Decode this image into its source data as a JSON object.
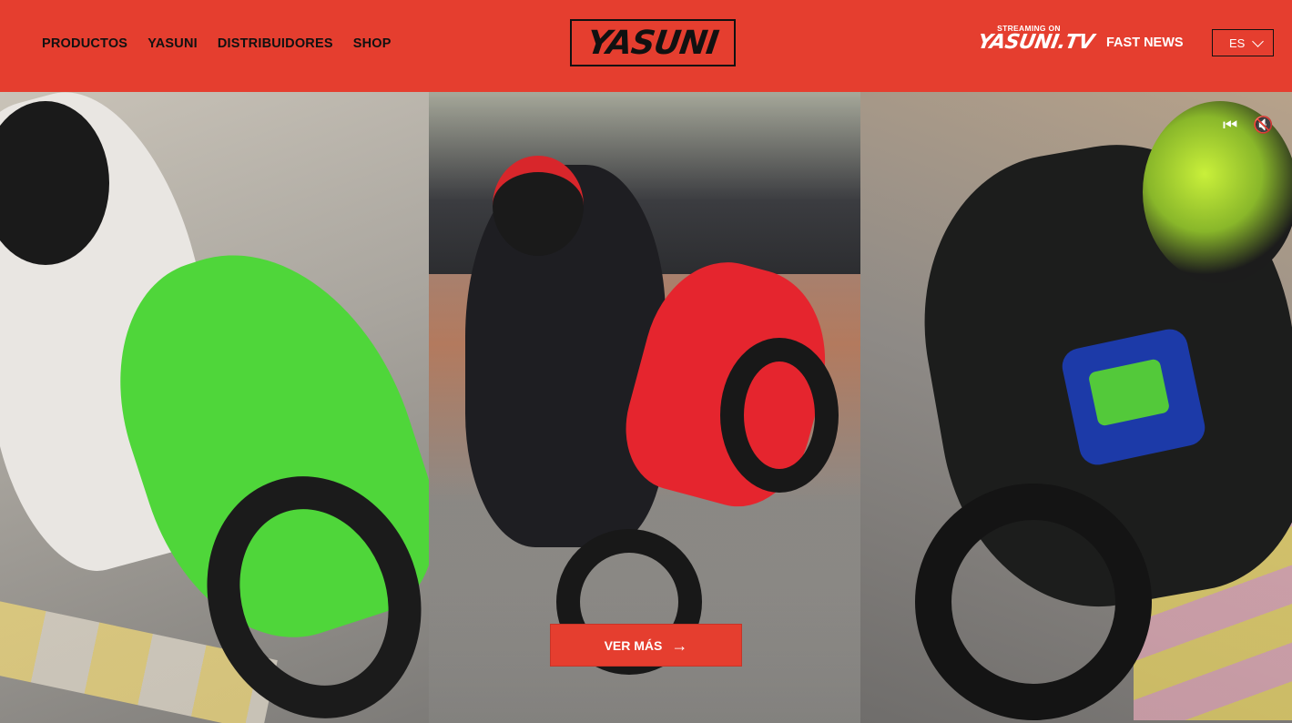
{
  "header": {
    "nav": [
      "PRODUCTOS",
      "YASUNI",
      "DISTRIBUIDORES",
      "SHOP"
    ],
    "logo_text": "YASUNI",
    "streaming_label": "STREAMING ON",
    "streaming_brand": "YASUNI.TV",
    "fast_news": "FAST NEWS",
    "language": "ES",
    "colors": {
      "bar": "#e53e2f",
      "text": "#111111"
    }
  },
  "hero": {
    "panels": [
      "green-scooter-racer",
      "red-scooter-wheelie",
      "blue-minibike-racer"
    ],
    "cta_label": "VER MÁS",
    "controls": {
      "rewind_icon": "rewind-icon",
      "mute_icon": "mute-icon"
    }
  }
}
